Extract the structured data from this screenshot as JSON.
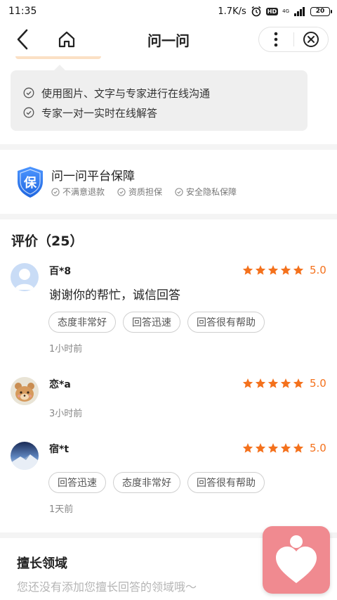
{
  "status_bar": {
    "time": "11:35",
    "speed": "1.7K/s",
    "hd": "HD",
    "network": "4G",
    "battery": "20"
  },
  "nav": {
    "title": "问一问",
    "icons": [
      "back-icon",
      "home-icon",
      "more-icon",
      "close-icon"
    ]
  },
  "features": [
    "使用图片、文字与专家进行在线沟通",
    "专家一对一实时在线解答"
  ],
  "guarantee": {
    "badge": "保",
    "title": "问一问平台保障",
    "items": [
      "不满意退款",
      "资质担保",
      "安全隐私保障"
    ]
  },
  "reviews": {
    "title": "评价（25）",
    "items": [
      {
        "name": "百*8",
        "rating": 5,
        "score": "5.0",
        "text": "谢谢你的帮忙，诚信回答",
        "tags": [
          "态度非常好",
          "回答迅速",
          "回答很有帮助"
        ],
        "time": "1小时前"
      },
      {
        "name": "恋*a",
        "rating": 5,
        "score": "5.0",
        "text": "",
        "tags": [],
        "time": "3小时前"
      },
      {
        "name": "宿*t",
        "rating": 5,
        "score": "5.0",
        "text": "",
        "tags": [
          "回答迅速",
          "态度非常好",
          "回答很有帮助"
        ],
        "time": "1天前"
      }
    ]
  },
  "expertise": {
    "title": "擅长领域",
    "empty_text": "您还没有添加您擅长回答的领域哦～"
  },
  "colors": {
    "accent": "#f4711c",
    "shield": "#2f7df6",
    "float_button": "#f08a90"
  }
}
